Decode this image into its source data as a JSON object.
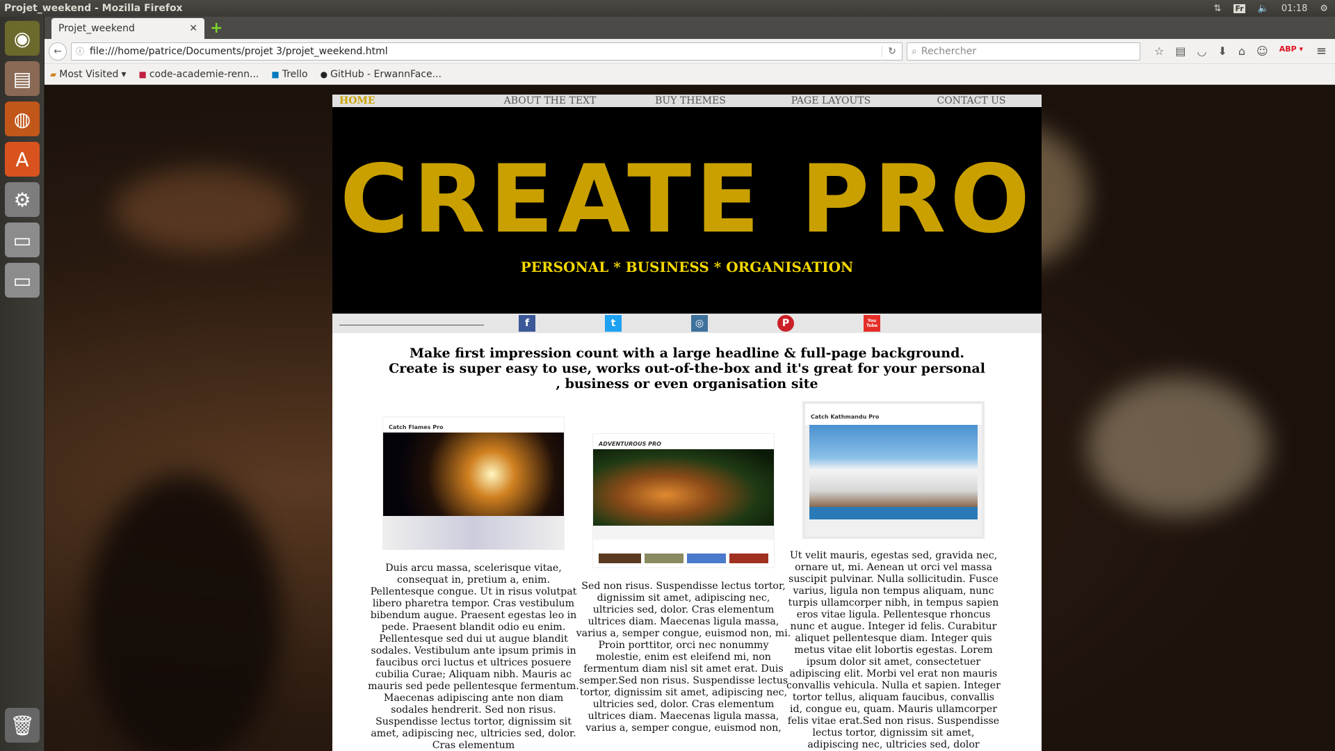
{
  "os": {
    "window_title": "Projet_weekend - Mozilla Firefox",
    "keyboard": "Fr",
    "clock": "01:18"
  },
  "browser": {
    "tab_title": "Projet_weekend",
    "url": "file:///home/patrice/Documents/projet 3/projet_weekend.html",
    "search_placeholder": "Rechercher",
    "bookmarks": [
      "Most Visited",
      "code-academie-renn...",
      "Trello",
      "GitHub - ErwannFace..."
    ]
  },
  "site": {
    "nav": [
      "HOME",
      "ABOUT THE TEXT",
      "BUY THEMES",
      "PAGE LAYOUTS",
      "CONTACT US"
    ],
    "hero_title": "CREATE PRO",
    "tagline": "PERSONAL * BUSINESS * ORGANISATION",
    "social": [
      "f",
      "t",
      "◎",
      "P",
      "You Tube"
    ],
    "intro": "Make first impression count with a large headline & full-page background. Create is super easy to use, works out-of-the-box and it's great for your personal , business or even organisation site",
    "columns": [
      {
        "thumb_title": "Catch Flames Pro",
        "text": "Duis arcu massa, scelerisque vitae, consequat in, pretium a, enim. Pellentesque congue. Ut in risus volutpat libero pharetra tempor. Cras vestibulum bibendum augue. Praesent egestas leo in pede. Praesent blandit odio eu enim. Pellentesque sed dui ut augue blandit sodales. Vestibulum ante ipsum primis in faucibus orci luctus et ultrices posuere cubilia Curae; Aliquam nibh. Mauris ac mauris sed pede pellentesque fermentum. Maecenas adipiscing ante non diam sodales hendrerit. Sed non risus. Suspendisse lectus tortor, dignissim sit amet, adipiscing nec, ultricies sed, dolor. Cras elementum"
      },
      {
        "thumb_title": "ADVENTUROUS PRO",
        "text": "Sed non risus. Suspendisse lectus tortor, dignissim sit amet, adipiscing nec, ultricies sed, dolor. Cras elementum ultrices diam. Maecenas ligula massa, varius a, semper congue, euismod non, mi. Proin porttitor, orci nec nonummy molestie, enim est eleifend mi, non fermentum diam nisl sit amet erat. Duis semper.Sed non risus. Suspendisse lectus tortor, dignissim sit amet, adipiscing nec, ultricies sed, dolor. Cras elementum ultrices diam. Maecenas ligula massa, varius a, semper congue, euismod non,"
      },
      {
        "thumb_title": "Catch Kathmandu Pro",
        "text": "Ut velit mauris, egestas sed, gravida nec, ornare ut, mi. Aenean ut orci vel massa suscipit pulvinar. Nulla sollicitudin. Fusce varius, ligula non tempus aliquam, nunc turpis ullamcorper nibh, in tempus sapien eros vitae ligula. Pellentesque rhoncus nunc et augue. Integer id felis. Curabitur aliquet pellentesque diam. Integer quis metus vitae elit lobortis egestas. Lorem ipsum dolor sit amet, consectetuer adipiscing elit. Morbi vel erat non mauris convallis vehicula. Nulla et sapien. Integer tortor tellus, aliquam faucibus, convallis id, congue eu, quam. Mauris ullamcorper felis vitae erat.Sed non risus. Suspendisse lectus tortor, dignissim sit amet, adipiscing nec, ultricies sed, dolor"
      }
    ]
  },
  "colors": {
    "hero_title": "#c9a000",
    "tagline": "#f5d800",
    "nav_active": "#c9a400",
    "facebook": "#3b5998",
    "twitter": "#1da1f2",
    "instagram": "#3f729b",
    "pinterest": "#cb2027",
    "youtube": "#e52d27"
  }
}
